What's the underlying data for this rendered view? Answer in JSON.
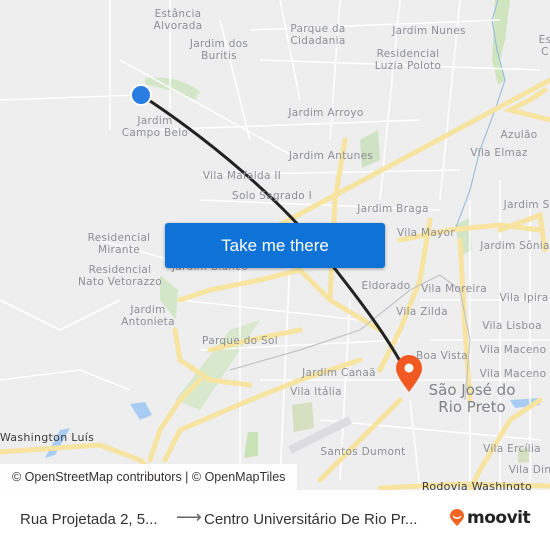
{
  "map": {
    "labels": [
      {
        "text": "Estância\nAlvorada",
        "kind": "area"
      },
      {
        "text": "Jardim dos\nBuritis",
        "kind": "area"
      },
      {
        "text": "Parque da\nCidadania",
        "kind": "area"
      },
      {
        "text": "Jardim Nunes",
        "kind": "area"
      },
      {
        "text": "Residencial\nLuzia Poloto",
        "kind": "area"
      },
      {
        "text": "Jardim Arroyo",
        "kind": "area"
      },
      {
        "text": "Jardim\nCampo Belo",
        "kind": "area"
      },
      {
        "text": "Jardim Antunes",
        "kind": "area"
      },
      {
        "text": "Azulão",
        "kind": "area"
      },
      {
        "text": "Vila Elmaz",
        "kind": "area"
      },
      {
        "text": "Vila Mafalda II",
        "kind": "area"
      },
      {
        "text": "Solo Sagrado I",
        "kind": "area"
      },
      {
        "text": "Jardim Braga",
        "kind": "area"
      },
      {
        "text": "Jardim Se",
        "kind": "area"
      },
      {
        "text": "Vila Mayor",
        "kind": "area"
      },
      {
        "text": "Jardim Sônia",
        "kind": "area"
      },
      {
        "text": "Residencial\nMirante",
        "kind": "area"
      },
      {
        "text": "Jardim Blanco",
        "kind": "area"
      },
      {
        "text": "Residencial\nNato Vetorazzo",
        "kind": "area"
      },
      {
        "text": "Eldorado",
        "kind": "area"
      },
      {
        "text": "Vila Moreira",
        "kind": "area"
      },
      {
        "text": "Vila Ipira",
        "kind": "area"
      },
      {
        "text": "Jardim\nAntonieta",
        "kind": "area"
      },
      {
        "text": "Vila Zilda",
        "kind": "area"
      },
      {
        "text": "Vila Lisboa",
        "kind": "area"
      },
      {
        "text": "Parque do Sol",
        "kind": "area"
      },
      {
        "text": "Boa Vista",
        "kind": "area"
      },
      {
        "text": "Vila Maceno",
        "kind": "area"
      },
      {
        "text": "Vila Maceno",
        "kind": "area"
      },
      {
        "text": "Jardim Canaã",
        "kind": "area"
      },
      {
        "text": "Vila Itália",
        "kind": "area"
      },
      {
        "text": "São José do\nRio Preto",
        "kind": "city"
      },
      {
        "text": "Washington Luís",
        "kind": "road"
      },
      {
        "text": "Santos Dumont",
        "kind": "area"
      },
      {
        "text": "Vila Ercília",
        "kind": "area"
      },
      {
        "text": "Vila Din",
        "kind": "area"
      },
      {
        "text": "Rodovia Washingto",
        "kind": "road"
      },
      {
        "text": "Es\nC",
        "kind": "area"
      }
    ],
    "origin_marker_color": "#2a7de1",
    "destination_marker_color": "#f05a22",
    "route_color": "#222222",
    "cta_button": "Take me there",
    "cta_color": "#0e72d6",
    "attribution": "© OpenStreetMap contributors | © OpenMapTiles"
  },
  "footer": {
    "from": "Rua Projetada 2, 5...",
    "arrow": "⟶",
    "to": "Centro Universitário De Rio Pr...",
    "brand": "moovit",
    "brand_color": "#f26522"
  }
}
